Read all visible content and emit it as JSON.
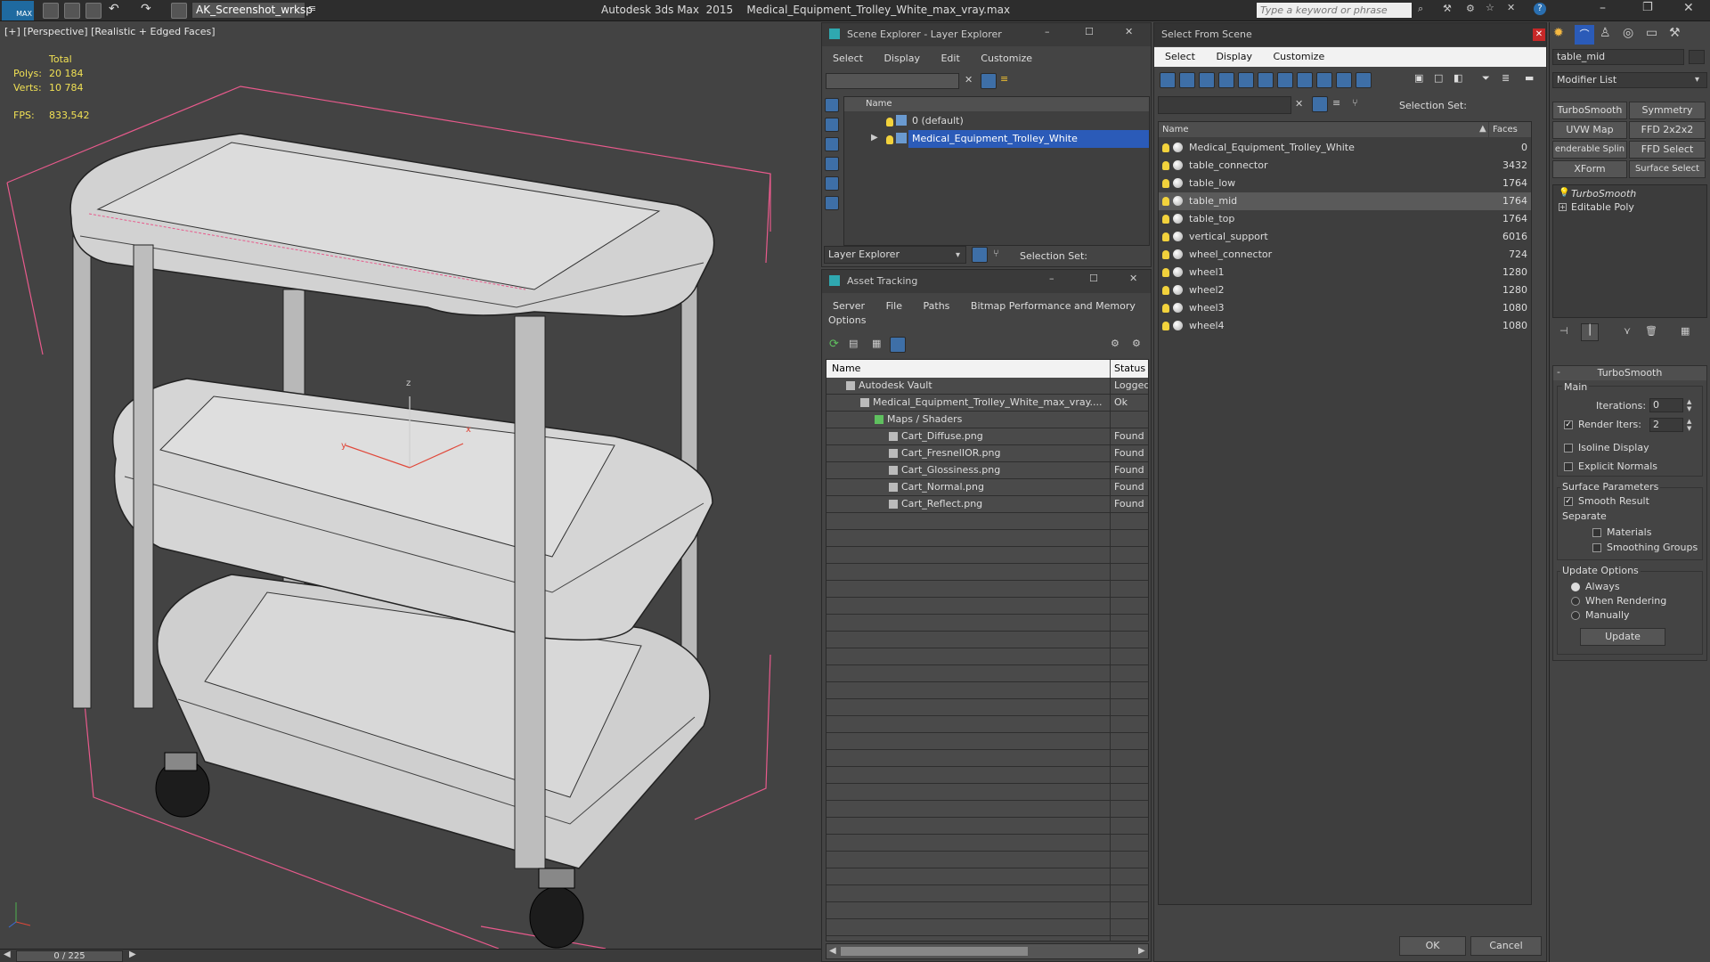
{
  "app": {
    "title": "Autodesk 3ds Max  2015    Medical_Equipment_Trolley_White_max_vray.max",
    "logo": "MAX",
    "workspace": "AK_Screenshot_wrksp",
    "search_placeholder": "Type a keyword or phrase"
  },
  "viewport": {
    "label": "[+] [Perspective] [Realistic + Edged Faces]",
    "stats_total": "Total",
    "polys_label": "Polys:",
    "polys_value": "20 184",
    "verts_label": "Verts:",
    "verts_value": "10 784",
    "fps_label": "FPS:",
    "fps_value": "833,542",
    "axis_x": "x",
    "axis_y": "y",
    "axis_z": "z"
  },
  "timeline": {
    "frame": "0 / 225"
  },
  "scene_explorer": {
    "title": "Scene Explorer - Layer Explorer",
    "menu": [
      "Select",
      "Display",
      "Edit",
      "Customize"
    ],
    "col_name": "Name",
    "rows": [
      "0 (default)",
      "Medical_Equipment_Trolley_White"
    ],
    "footer_dropdown": "Layer Explorer",
    "selection_set": "Selection Set:"
  },
  "asset_tracking": {
    "title": "Asset Tracking",
    "menu": [
      "Server",
      "File",
      "Paths",
      "Bitmap Performance and Memory"
    ],
    "menu2": "Options",
    "col_name": "Name",
    "col_status": "Status",
    "rows": [
      {
        "name": "Autodesk Vault",
        "status": "Logged",
        "indent": 0
      },
      {
        "name": "Medical_Equipment_Trolley_White_max_vray....",
        "status": "Ok",
        "indent": 1
      },
      {
        "name": "Maps / Shaders",
        "status": "",
        "indent": 2
      },
      {
        "name": "Cart_Diffuse.png",
        "status": "Found",
        "indent": 3
      },
      {
        "name": "Cart_FresnelIOR.png",
        "status": "Found",
        "indent": 3
      },
      {
        "name": "Cart_Glossiness.png",
        "status": "Found",
        "indent": 3
      },
      {
        "name": "Cart_Normal.png",
        "status": "Found",
        "indent": 3
      },
      {
        "name": "Cart_Reflect.png",
        "status": "Found",
        "indent": 3
      }
    ]
  },
  "select_from_scene": {
    "title": "Select From Scene",
    "menu": [
      "Select",
      "Display",
      "Customize"
    ],
    "selection_set": "Selection Set:",
    "col_name": "Name",
    "col_faces": "Faces",
    "rows": [
      {
        "name": "Medical_Equipment_Trolley_White",
        "faces": "0"
      },
      {
        "name": "table_connector",
        "faces": "3432"
      },
      {
        "name": "table_low",
        "faces": "1764"
      },
      {
        "name": "table_mid",
        "faces": "1764"
      },
      {
        "name": "table_top",
        "faces": "1764"
      },
      {
        "name": "vertical_support",
        "faces": "6016"
      },
      {
        "name": "wheel_connector",
        "faces": "724"
      },
      {
        "name": "wheel1",
        "faces": "1280"
      },
      {
        "name": "wheel2",
        "faces": "1280"
      },
      {
        "name": "wheel3",
        "faces": "1080"
      },
      {
        "name": "wheel4",
        "faces": "1080"
      }
    ],
    "ok": "OK",
    "cancel": "Cancel"
  },
  "command_panel": {
    "object_name": "table_mid",
    "modifier_list": "Modifier List",
    "buttons": [
      "TurboSmooth",
      "Symmetry",
      "UVW Map",
      "FFD 2x2x2",
      "enderable Splin",
      "FFD Select",
      "XForm",
      "Surface Select"
    ],
    "stack": [
      "TurboSmooth",
      "Editable Poly"
    ],
    "rollout_title": "TurboSmooth",
    "main": "Main",
    "iterations_label": "Iterations:",
    "iterations_value": "0",
    "render_iters_label": "Render Iters:",
    "render_iters_value": "2",
    "isoline": "Isoline Display",
    "explicit_normals": "Explicit Normals",
    "surface_params": "Surface Parameters",
    "smooth_result": "Smooth Result",
    "separate": "Separate",
    "materials": "Materials",
    "smoothing_groups": "Smoothing Groups",
    "update_options": "Update Options",
    "always": "Always",
    "when_rendering": "When Rendering",
    "manually": "Manually",
    "update": "Update"
  }
}
